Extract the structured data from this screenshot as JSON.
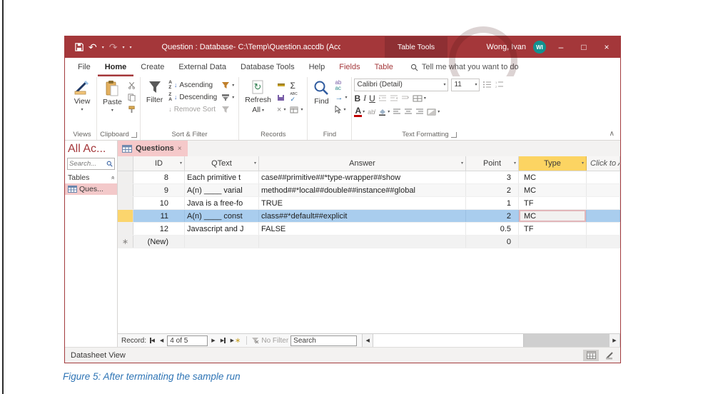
{
  "window": {
    "title": "Question : Database- C:\\Temp\\Question.accdb (Acces...",
    "context_group": "Table Tools",
    "user": "Wong, Ivan",
    "user_initials": "WI",
    "minimize": "–",
    "maximize": "□",
    "close": "×"
  },
  "ribbon": {
    "tabs": {
      "file": "File",
      "home": "Home",
      "create": "Create",
      "external_data": "External Data",
      "database_tools": "Database Tools",
      "help": "Help",
      "fields": "Fields",
      "table": "Table"
    },
    "tell_me": "Tell me what you want to do",
    "views": {
      "view": "View",
      "label": "Views"
    },
    "clipboard": {
      "paste": "Paste",
      "label": "Clipboard"
    },
    "sort_filter": {
      "filter": "Filter",
      "ascending": "Ascending",
      "descending": "Descending",
      "remove_sort": "Remove Sort",
      "label": "Sort & Filter"
    },
    "records": {
      "refresh_1": "Refresh",
      "refresh_2": "All",
      "label": "Records"
    },
    "find": {
      "find": "Find",
      "label": "Find"
    },
    "text_formatting": {
      "font_name": "Calibri (Detail)",
      "font_size": "11",
      "bold": "B",
      "italic": "I",
      "underline": "U",
      "font_color": "A",
      "label": "Text Formatting"
    }
  },
  "nav_pane": {
    "title": "All Ac...",
    "search_placeholder": "Search...",
    "tables_group": "Tables",
    "items": [
      {
        "label": "Ques..."
      }
    ]
  },
  "datasheet": {
    "tab_label": "Questions",
    "columns": {
      "id": "ID",
      "qtext": "QText",
      "answer": "Answer",
      "point": "Point",
      "type": "Type",
      "add": "Click to A"
    },
    "rows": [
      {
        "id": "8",
        "qtext": "Each primitive t",
        "answer": "case##primitive##*type-wrapper##show",
        "point": "3",
        "type": "MC",
        "selected": false
      },
      {
        "id": "9",
        "qtext": "A(n) ____ varial",
        "answer": "method##*local##double##instance##global",
        "point": "2",
        "type": "MC",
        "selected": false
      },
      {
        "id": "10",
        "qtext": "Java is a free-fo",
        "answer": "TRUE",
        "point": "1",
        "type": "TF",
        "selected": false
      },
      {
        "id": "11",
        "qtext": "A(n) ____ const",
        "answer": "class##*default##explicit",
        "point": "2",
        "type": "MC",
        "selected": true
      },
      {
        "id": "12",
        "qtext": "Javascript and J",
        "answer": "FALSE",
        "point": "0.5",
        "type": "TF",
        "selected": false
      }
    ],
    "new_row": {
      "id": "(New)",
      "point": "0"
    }
  },
  "record_nav": {
    "label": "Record:",
    "position": "4 of 5",
    "no_filter": "No Filter",
    "search_placeholder": "Search"
  },
  "status_bar": {
    "view_name": "Datasheet View"
  },
  "caption": "Figure 5: After terminating the sample run",
  "colors": {
    "titlebar_red": "#a4373a",
    "context_block_red": "#8e2f33",
    "contextual_tab_red": "#a4373a",
    "selection_blue": "#a9cdee",
    "row_selector_gold": "#fbd56d",
    "type_header_yellow": "#fcd462",
    "tab_pink": "#f5c9ca",
    "caption_blue": "#2e74b5",
    "avatar_teal": "#12918f",
    "font_color_red": "#c00000"
  }
}
